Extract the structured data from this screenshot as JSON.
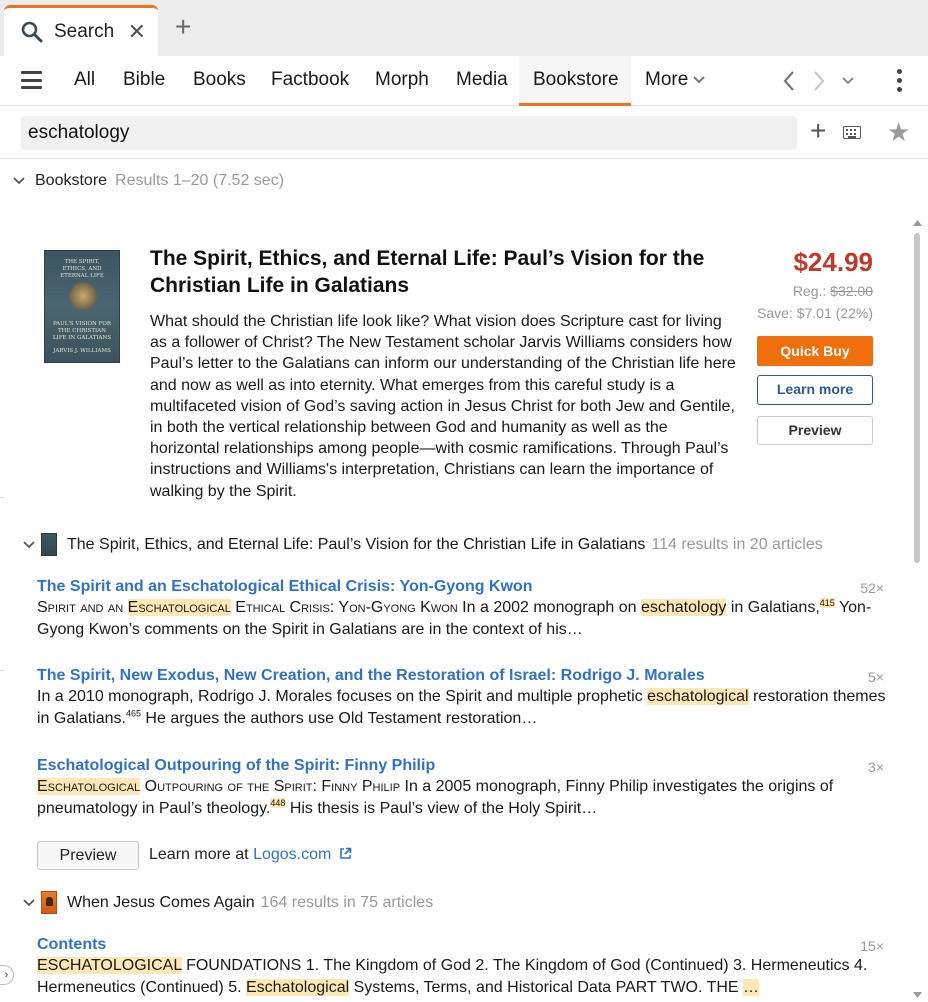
{
  "tab": {
    "title": "Search",
    "icon": "search-icon",
    "close_glyph": "✕",
    "add_glyph": "+"
  },
  "nav": {
    "tabs": [
      "All",
      "Bible",
      "Books",
      "Factbook",
      "Morph",
      "Media",
      "Bookstore",
      "More"
    ],
    "active": "Bookstore",
    "accent_color": "#f0731e"
  },
  "search": {
    "query": "eschatology"
  },
  "section": {
    "title": "Bookstore",
    "summary": "Results 1–20 (7.52 sec)"
  },
  "product": {
    "cover": {
      "line1": "THE SPIRIT,",
      "line2": "ETHICS, AND",
      "line3": "ETERNAL LIFE",
      "line4": "PAUL'S VISION FOR",
      "line5": "THE CHRISTIAN",
      "line6": "LIFE IN GALATIANS",
      "author": "JARVIS J. WILLIAMS"
    },
    "title": "The Spirit, Ethics, and Eternal Life: Paul’s Vision for the Christian Life in Galatians",
    "description": "What should the Christian life look like? What vision does Scripture cast for living as a follower of Christ? The New Testament scholar Jarvis Williams considers how Paul’s letter to the Galatians can inform our understanding of the Christian life here and now as well as into eternity. What emerges from this careful study is a multifaceted vision of God’s saving action in Jesus Christ for both Jew and Gentile, in both the vertical relationship between God and humanity as well as the horizontal relationships among people—with cosmic ramifications. Through Paul’s instructions and Williams's interpretation, Christians can learn the importance of walking by the Spirit.",
    "price": "$24.99",
    "reg_label": "Reg.: ",
    "reg_price": "$32.00",
    "save": "Save: $7.01 (22%)",
    "quick_buy": "Quick Buy",
    "learn_more": "Learn more",
    "preview": "Preview",
    "price_color": "#c0392b",
    "quick_buy_color": "#f16e0d"
  },
  "groups": [
    {
      "title": "The Spirit, Ethics, and Eternal Life: Paul’s Vision for the Christian Life in Galatians",
      "meta": "114 results in 20 articles",
      "results": [
        {
          "title": "The Spirit and an Eschatological Ethical Crisis: Yon-Gyong Kwon",
          "count": "52×",
          "s1": "Spirit and an ",
          "h1": "Eschatological",
          "s2": " Ethical Crisis: Yon-Gyong Kwon",
          "s3": " In a 2002 monograph on ",
          "h2": "eschatology",
          "s4": " in Galatians,",
          "sup": "415",
          "s5": " Yon-Gyong Kwon’s comments on the Spirit in Galatians are in the context of his…"
        },
        {
          "title": "The Spirit, New Exodus, New Creation, and the Restoration of Israel: Rodrigo J. Morales",
          "count": "5×",
          "s1": "In a 2010 monograph, Rodrigo J. Morales focuses on the Spirit and multiple prophetic ",
          "h1": "eschatological",
          "s2": " restoration themes in Galatians.",
          "sup": "465",
          "s3": " He argues the authors use Old Testament restoration…"
        },
        {
          "title": "Eschatological Outpouring of the Spirit: Finny Philip",
          "count": "3×",
          "h1": "Eschatological",
          "s1": " Outpouring of the Spirit: Finny Philip",
          "s2": " In a 2005 monograph, Finny Philip investigates the origins of pneumatology in Paul’s theology.",
          "sup": "448",
          "s3": " His thesis is Paul’s view of the Holy Spirit…"
        }
      ],
      "preview_label": "Preview",
      "learn_more_prefix": "Learn more at ",
      "learn_more_link": "Logos.com"
    },
    {
      "title": "When Jesus Comes Again",
      "meta": "164 results in 75 articles",
      "results": [
        {
          "title": "Contents",
          "count": "15×",
          "h1": "ESCHATOLOGICAL",
          "s1": " FOUNDATIONS 1. The Kingdom of God 2. The Kingdom of God (Continued) 3. Hermeneutics 4. Hermeneutics (Continued) 5. ",
          "h2": "Eschatological",
          "s2": " Systems, Terms, and Historical Data PART TWO. THE ",
          "h3": "…"
        }
      ]
    }
  ]
}
